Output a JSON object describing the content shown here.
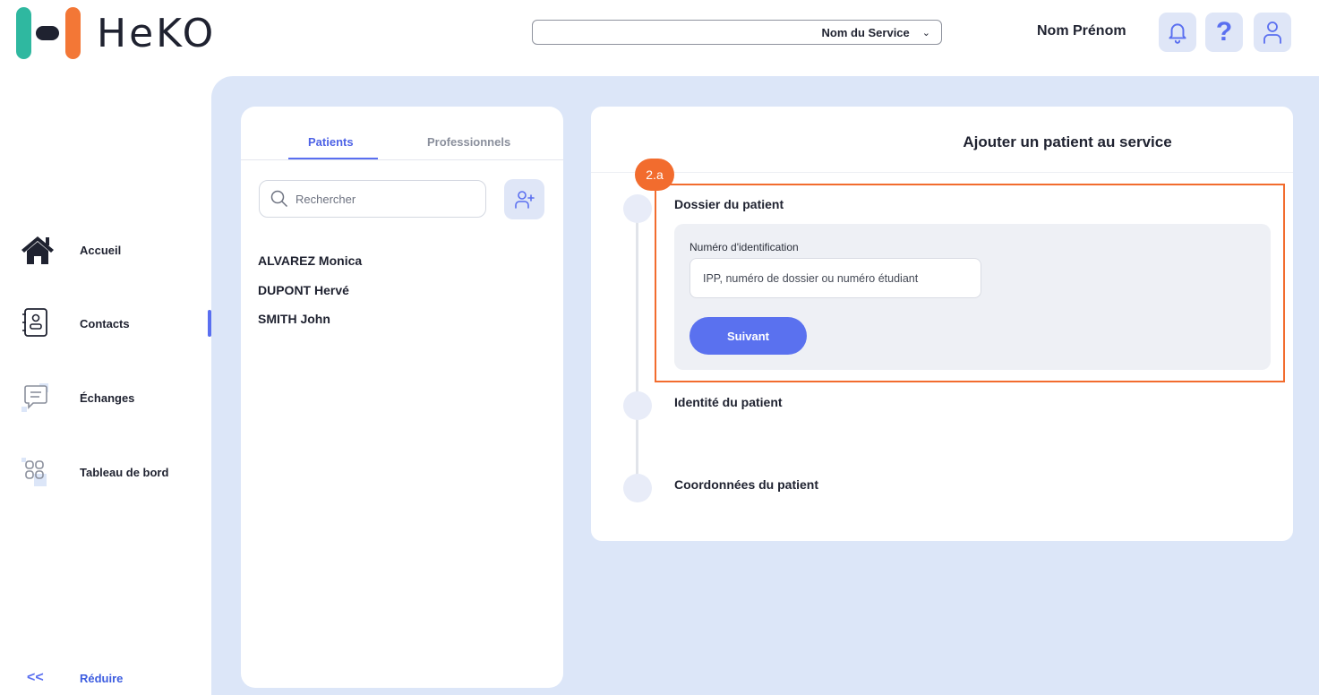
{
  "brand": {
    "name": "HeKO"
  },
  "header": {
    "service_select": {
      "value": "Nom du Service"
    },
    "user_name": "Nom Prénom",
    "help_glyph": "?"
  },
  "nav": {
    "items": [
      {
        "label": "Accueil",
        "icon": "home-icon"
      },
      {
        "label": "Contacts",
        "icon": "contacts-icon",
        "active": true
      },
      {
        "label": "Échanges",
        "icon": "chat-icon"
      },
      {
        "label": "Tableau de bord",
        "icon": "dashboard-icon"
      }
    ],
    "reduce_label": "Réduire",
    "reduce_glyph": "<<"
  },
  "list_panel": {
    "tabs": [
      {
        "label": "Patients",
        "active": true
      },
      {
        "label": "Professionnels",
        "active": false
      }
    ],
    "search": {
      "placeholder": "Rechercher"
    },
    "patients": [
      "ALVAREZ Monica",
      "DUPONT Hervé",
      "SMITH John"
    ]
  },
  "form": {
    "title": "Ajouter un patient au service",
    "step_badge": "2.a",
    "steps": [
      {
        "label": "Dossier du patient",
        "active": true
      },
      {
        "label": "Identité du patient",
        "active": false
      },
      {
        "label": "Coordonnées du patient",
        "active": false
      }
    ],
    "id_field": {
      "label": "Numéro d'identification",
      "placeholder": "IPP, numéro de dossier ou numéro étudiant",
      "value": ""
    },
    "next_button": "Suivant"
  },
  "colors": {
    "accent": "#5a6ff0",
    "highlight": "#f26c2e",
    "background": "#dce6f8",
    "logo_green": "#2fb8a0",
    "logo_orange": "#f37736"
  }
}
